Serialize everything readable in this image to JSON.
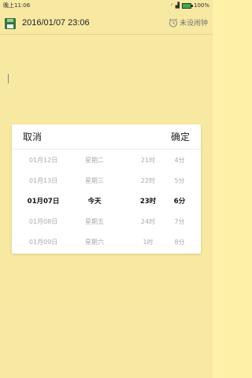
{
  "status_bar": {
    "time": "晚上11:06",
    "battery_text": "100%",
    "battery_level": 1.0
  },
  "header": {
    "datetime": "2016/01/07 23:06",
    "alarm_label": "未设闹钟",
    "save_icon": "save-icon",
    "alarm_icon": "alarm-clock-icon"
  },
  "picker": {
    "cancel_label": "取消",
    "confirm_label": "确定",
    "rows": [
      {
        "date": "01月12日",
        "week": "星期二",
        "hour": "21时",
        "min": "4分"
      },
      {
        "date": "01月13日",
        "week": "星期三",
        "hour": "22时",
        "min": "5分"
      },
      {
        "date": "01月07日",
        "week": "今天",
        "hour": "23时",
        "min": "6分"
      },
      {
        "date": "01月08日",
        "week": "星期五",
        "hour": "24时",
        "min": "7分"
      },
      {
        "date": "01月09日",
        "week": "星期六",
        "hour": "1时",
        "min": "8分"
      }
    ],
    "selected_index": 2
  }
}
